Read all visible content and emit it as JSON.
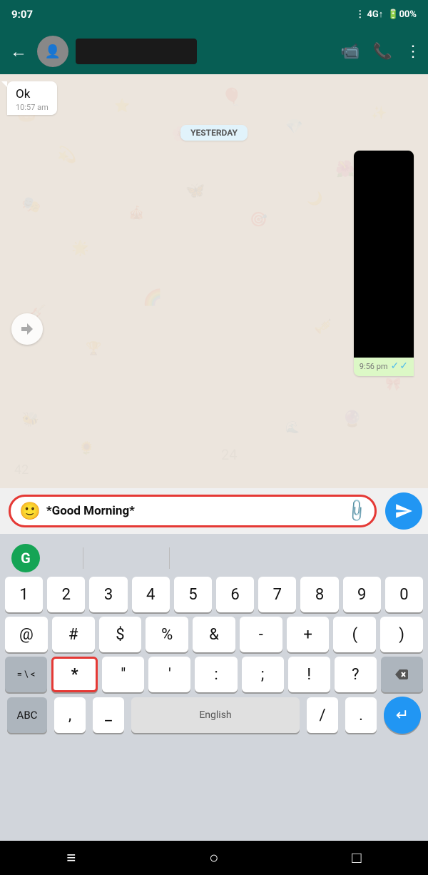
{
  "statusBar": {
    "time": "9:07",
    "signal": "4G↑",
    "battery": "00%"
  },
  "header": {
    "backLabel": "←",
    "videoCallIcon": "📹",
    "callIcon": "📞",
    "menuIcon": "⋮"
  },
  "chat": {
    "incomingMessage": {
      "text": "Ok",
      "time": "10:57 am"
    },
    "daySeparator": "YESTERDAY",
    "videoMessage": {
      "time": "9:56 pm"
    }
  },
  "inputBar": {
    "emojiIcon": "🙂",
    "text": "*Good Morning*",
    "attachIcon": "📎",
    "sendIcon": "➤"
  },
  "keyboard": {
    "grammarlyLabel": "G",
    "row1": [
      "1",
      "2",
      "3",
      "4",
      "5",
      "6",
      "7",
      "8",
      "9",
      "0"
    ],
    "row2": [
      "@",
      "#",
      "$",
      "%",
      "&",
      "-",
      "+",
      "(",
      ")"
    ],
    "row3": [
      "=\\<",
      "*",
      "\"",
      "'",
      ":",
      ";",
      "!",
      "?",
      "⌫"
    ],
    "row4Left": [
      "ABC"
    ],
    "row4Mid": [
      ",",
      "_"
    ],
    "row4Space": "English",
    "row4Right": [
      "/",
      "."
    ],
    "enterIcon": "↵"
  },
  "navBar": {
    "homeIcon": "≡",
    "circleIcon": "○",
    "squareIcon": "□"
  }
}
